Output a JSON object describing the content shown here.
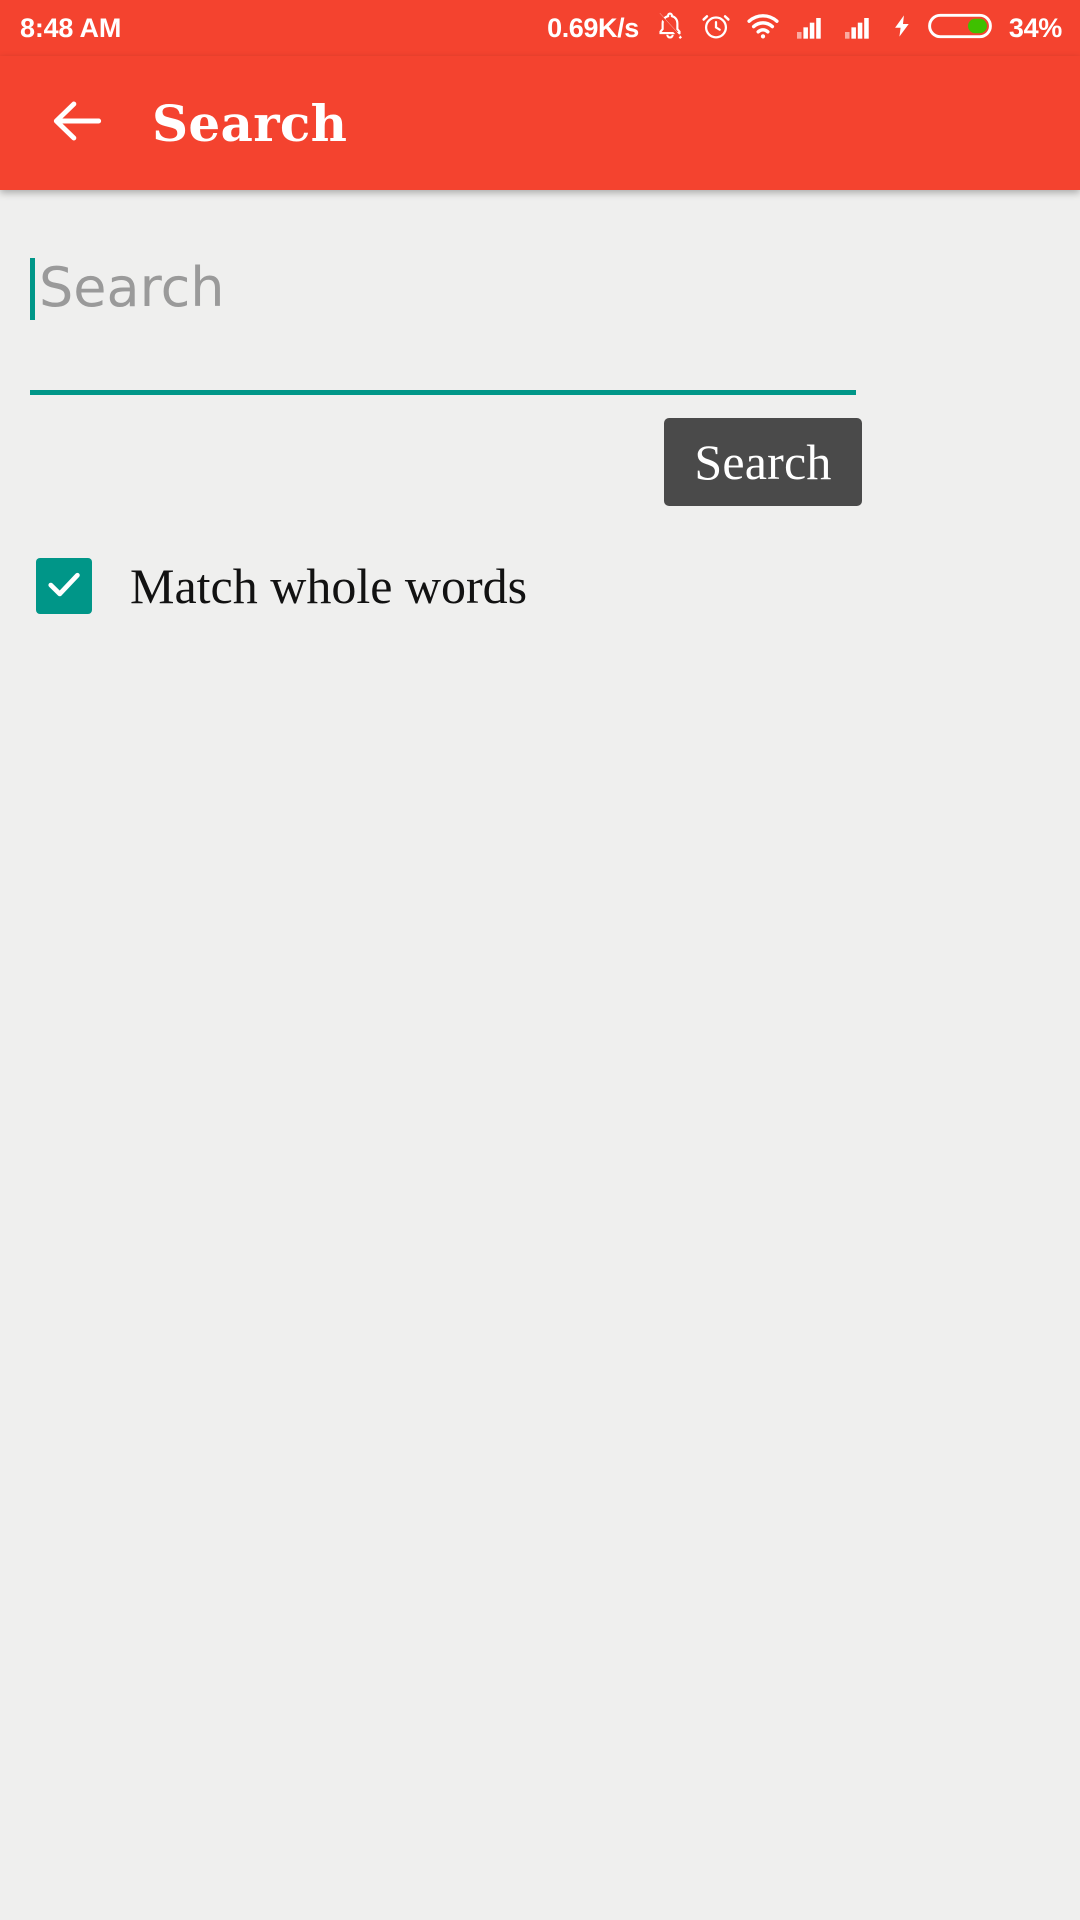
{
  "statusbar": {
    "time": "8:48 AM",
    "network_speed": "0.69K/s",
    "battery_percent": "34%",
    "icons": [
      "notifications-muted-icon",
      "alarm-clock-icon",
      "wifi-icon",
      "signal-bars-sim1-icon",
      "signal-bars-sim2-icon",
      "charging-bolt-icon",
      "battery-icon"
    ],
    "colors": {
      "background": "#F4432F",
      "foreground": "#FFFFFF",
      "battery_fill": "#3FC000"
    }
  },
  "appbar": {
    "title": "Search",
    "back_icon": "arrow-left-icon",
    "colors": {
      "background": "#F4432F",
      "title": "#FFFFFF"
    }
  },
  "search": {
    "input_value": "",
    "placeholder": "Search",
    "button_label": "Search",
    "colors": {
      "underline": "#009688",
      "caret": "#009688",
      "placeholder_text": "#9A9A9A",
      "button_background": "#4A4A4A",
      "button_text": "#FFFFFF"
    }
  },
  "options": {
    "match_whole_words": {
      "label": "Match whole words",
      "checked": true,
      "check_icon": "check-icon",
      "color": "#009688"
    }
  },
  "page": {
    "background": "#EFEFEE"
  }
}
